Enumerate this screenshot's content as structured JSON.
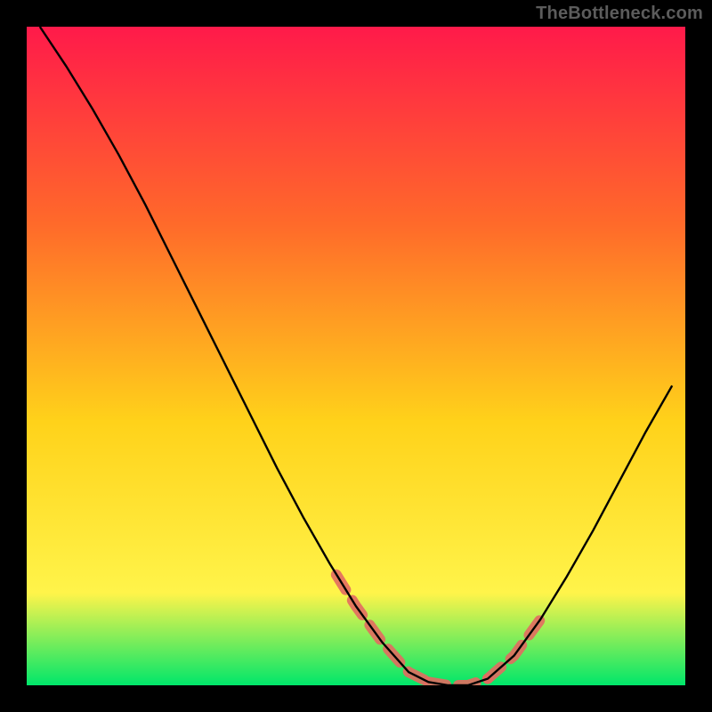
{
  "watermark": "TheBottleneck.com",
  "chart_data": {
    "type": "line",
    "title": "",
    "xlabel": "",
    "ylabel": "",
    "xlim": [
      0,
      1
    ],
    "ylim": [
      0,
      1
    ],
    "gradient_colors": {
      "top": "#ff1a4a",
      "mid_top": "#ff6a2a",
      "mid": "#ffd21a",
      "mid_bottom": "#fff44a",
      "bottom": "#00e66a"
    },
    "plot_background": "#000000",
    "curve_color": "#000000",
    "curve_stroke_width": 2.4,
    "highlight_color": "#e36a61",
    "highlight_stroke_width": 12,
    "series": [
      {
        "name": "bottleneck-curve",
        "x": [
          0.02,
          0.06,
          0.1,
          0.14,
          0.18,
          0.22,
          0.26,
          0.3,
          0.34,
          0.38,
          0.42,
          0.46,
          0.5,
          0.54,
          0.58,
          0.61,
          0.64,
          0.67,
          0.7,
          0.74,
          0.78,
          0.82,
          0.86,
          0.9,
          0.94,
          0.98
        ],
        "y": [
          1.0,
          0.94,
          0.875,
          0.805,
          0.73,
          0.65,
          0.57,
          0.49,
          0.41,
          0.33,
          0.255,
          0.185,
          0.12,
          0.065,
          0.02,
          0.005,
          0.0,
          0.0,
          0.01,
          0.045,
          0.1,
          0.165,
          0.235,
          0.31,
          0.385,
          0.455
        ]
      }
    ],
    "highlight_segments": [
      {
        "name": "left-tail",
        "x": [
          0.47,
          0.5,
          0.54,
          0.58,
          0.61
        ],
        "y": [
          0.168,
          0.12,
          0.065,
          0.02,
          0.005
        ]
      },
      {
        "name": "valley-floor",
        "x": [
          0.61,
          0.64,
          0.67,
          0.7
        ],
        "y": [
          0.005,
          0.0,
          0.0,
          0.01
        ]
      },
      {
        "name": "right-tail",
        "x": [
          0.7,
          0.74,
          0.78
        ],
        "y": [
          0.01,
          0.045,
          0.1
        ]
      }
    ]
  }
}
